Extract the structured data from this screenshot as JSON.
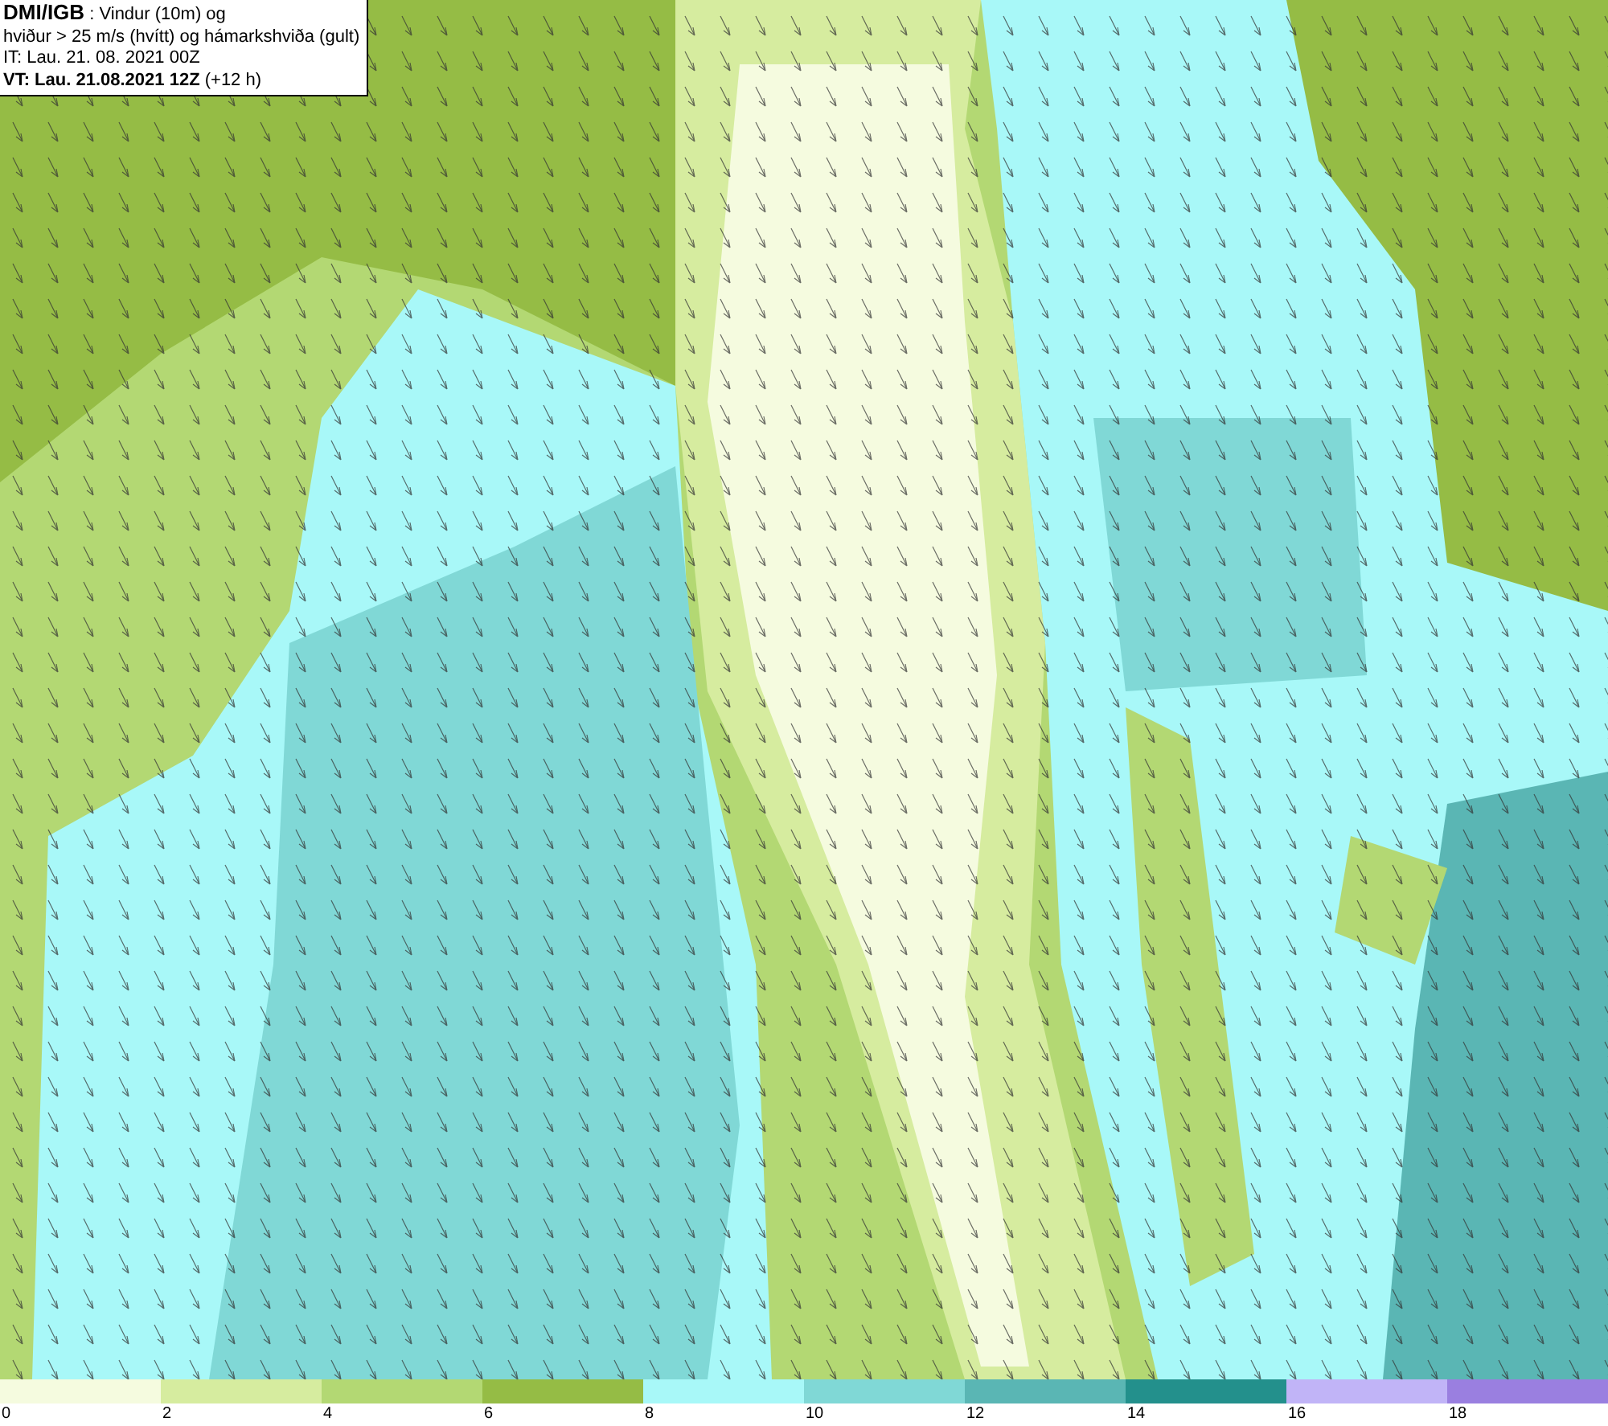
{
  "info_box": {
    "lines": [
      "**DMI/IGB** : Vindur (10m) og",
      "hviður > 25 m/s (hvítt) og hámarkshviða (gult)",
      "IT: Lau. 21. 08. 2021 00Z",
      "**VT: Lau. 21.08.2021 12Z** (+12 h)"
    ]
  },
  "legend": [
    {
      "label": "0",
      "color": "#f5fbdf"
    },
    {
      "label": "2",
      "color": "#d6ec9f"
    },
    {
      "label": "4",
      "color": "#b3d873"
    },
    {
      "label": "6",
      "color": "#95bc45"
    },
    {
      "label": "8",
      "color": "#a8f8f8"
    },
    {
      "label": "10",
      "color": "#80d8d6"
    },
    {
      "label": "12",
      "color": "#5ab6b4"
    },
    {
      "label": "14",
      "color": "#23908c"
    },
    {
      "label": "16",
      "color": "#c1b4f7"
    },
    {
      "label": "18",
      "color": "#9a7fe0"
    }
  ]
}
